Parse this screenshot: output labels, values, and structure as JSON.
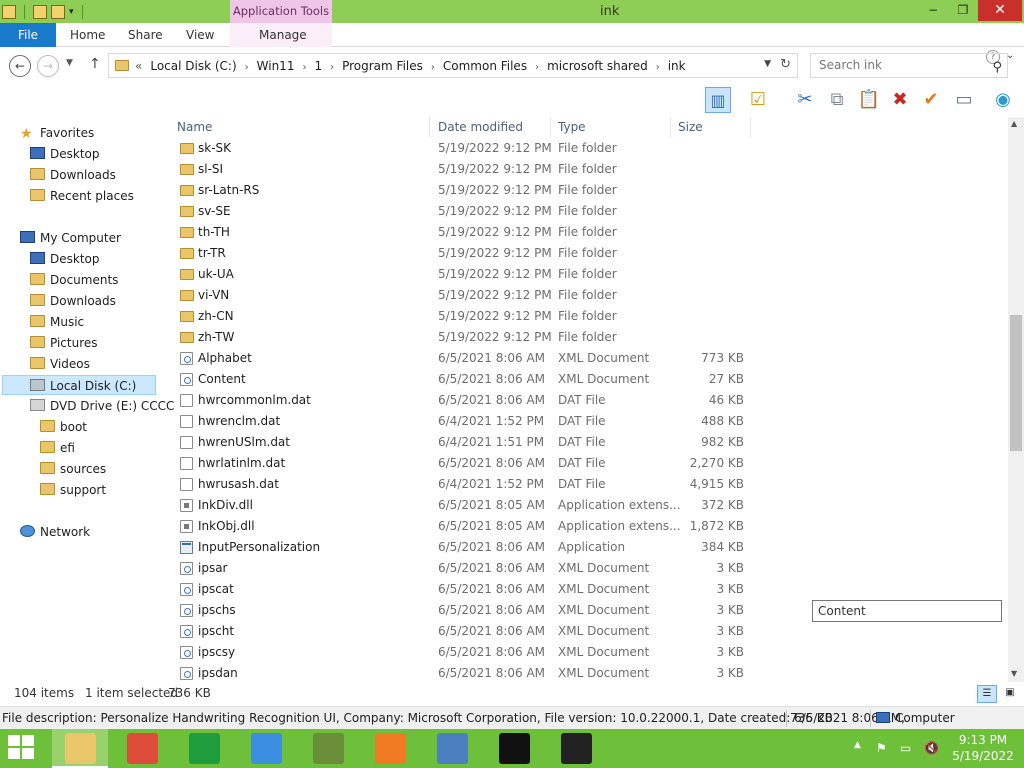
{
  "window": {
    "title": "ink",
    "context_tab_group": "Application Tools",
    "btn_min": "−",
    "btn_max": "❐",
    "btn_close": "✕"
  },
  "ribbon": {
    "tabs": [
      "File",
      "Home",
      "Share",
      "View",
      "Manage"
    ],
    "help_glyph": "?",
    "collapse_glyph": "⌄"
  },
  "address": {
    "overflow": "«",
    "crumbs": [
      "Local Disk (C:)",
      "Win11",
      "1",
      "Program Files",
      "Common Files",
      "microsoft shared",
      "ink"
    ],
    "separator": "›",
    "search_placeholder": "Search ink"
  },
  "nav_glyphs": {
    "back": "←",
    "forward": "→",
    "recent": "▼",
    "up": "↑",
    "dropdown": "▼",
    "refresh": "↻",
    "search": "⚲"
  },
  "toolbar_icons": [
    "layout-pane-icon",
    "properties-icon",
    "cut-icon",
    "copy-icon",
    "paste-icon",
    "delete-icon",
    "check-icon",
    "rename-icon",
    "globe-icon"
  ],
  "toolbar_glyphs": [
    "▥",
    "☑",
    "✂",
    "⧉",
    "📋",
    "✖",
    "✔",
    "▭",
    "◉"
  ],
  "navpane": {
    "favorites": {
      "label": "Favorites",
      "items": [
        "Desktop",
        "Downloads",
        "Recent places"
      ]
    },
    "computer": {
      "label": "My Computer",
      "items": [
        "Desktop",
        "Documents",
        "Downloads",
        "Music",
        "Pictures",
        "Videos",
        "Local Disk (C:)",
        "DVD Drive (E:) CCCC"
      ]
    },
    "dvd_children": [
      "boot",
      "efi",
      "sources",
      "support"
    ],
    "network": "Network"
  },
  "columns": {
    "name": "Name",
    "date": "Date modified",
    "type": "Type",
    "size": "Size",
    "sort_glyph": "^"
  },
  "files": [
    {
      "name": "sk-SK",
      "date": "5/19/2022 9:12 PM",
      "type": "File folder",
      "size": "",
      "icon": "folder"
    },
    {
      "name": "sl-SI",
      "date": "5/19/2022 9:12 PM",
      "type": "File folder",
      "size": "",
      "icon": "folder"
    },
    {
      "name": "sr-Latn-RS",
      "date": "5/19/2022 9:12 PM",
      "type": "File folder",
      "size": "",
      "icon": "folder"
    },
    {
      "name": "sv-SE",
      "date": "5/19/2022 9:12 PM",
      "type": "File folder",
      "size": "",
      "icon": "folder"
    },
    {
      "name": "th-TH",
      "date": "5/19/2022 9:12 PM",
      "type": "File folder",
      "size": "",
      "icon": "folder"
    },
    {
      "name": "tr-TR",
      "date": "5/19/2022 9:12 PM",
      "type": "File folder",
      "size": "",
      "icon": "folder"
    },
    {
      "name": "uk-UA",
      "date": "5/19/2022 9:12 PM",
      "type": "File folder",
      "size": "",
      "icon": "folder"
    },
    {
      "name": "vi-VN",
      "date": "5/19/2022 9:12 PM",
      "type": "File folder",
      "size": "",
      "icon": "folder"
    },
    {
      "name": "zh-CN",
      "date": "5/19/2022 9:12 PM",
      "type": "File folder",
      "size": "",
      "icon": "folder"
    },
    {
      "name": "zh-TW",
      "date": "5/19/2022 9:12 PM",
      "type": "File folder",
      "size": "",
      "icon": "folder"
    },
    {
      "name": "Alphabet",
      "date": "6/5/2021 8:06 AM",
      "type": "XML Document",
      "size": "773 KB",
      "icon": "xml"
    },
    {
      "name": "Content",
      "date": "6/5/2021 8:06 AM",
      "type": "XML Document",
      "size": "27 KB",
      "icon": "xml"
    },
    {
      "name": "hwrcommonlm.dat",
      "date": "6/5/2021 8:06 AM",
      "type": "DAT File",
      "size": "46 KB",
      "icon": "dat"
    },
    {
      "name": "hwrenclm.dat",
      "date": "6/4/2021 1:52 PM",
      "type": "DAT File",
      "size": "488 KB",
      "icon": "dat"
    },
    {
      "name": "hwrenUSlm.dat",
      "date": "6/4/2021 1:51 PM",
      "type": "DAT File",
      "size": "982 KB",
      "icon": "dat"
    },
    {
      "name": "hwrlatinlm.dat",
      "date": "6/5/2021 8:06 AM",
      "type": "DAT File",
      "size": "2,270 KB",
      "icon": "dat"
    },
    {
      "name": "hwrusash.dat",
      "date": "6/4/2021 1:52 PM",
      "type": "DAT File",
      "size": "4,915 KB",
      "icon": "dat"
    },
    {
      "name": "InkDiv.dll",
      "date": "6/5/2021 8:05 AM",
      "type": "Application extens...",
      "size": "372 KB",
      "icon": "dll"
    },
    {
      "name": "InkObj.dll",
      "date": "6/5/2021 8:05 AM",
      "type": "Application extens...",
      "size": "1,872 KB",
      "icon": "dll"
    },
    {
      "name": "InputPersonalization",
      "date": "6/5/2021 8:06 AM",
      "type": "Application",
      "size": "384 KB",
      "icon": "app"
    },
    {
      "name": "ipsar",
      "date": "6/5/2021 8:06 AM",
      "type": "XML Document",
      "size": "3 KB",
      "icon": "xml"
    },
    {
      "name": "ipscat",
      "date": "6/5/2021 8:06 AM",
      "type": "XML Document",
      "size": "3 KB",
      "icon": "xml"
    },
    {
      "name": "ipschs",
      "date": "6/5/2021 8:06 AM",
      "type": "XML Document",
      "size": "3 KB",
      "icon": "xml"
    },
    {
      "name": "ipscht",
      "date": "6/5/2021 8:06 AM",
      "type": "XML Document",
      "size": "3 KB",
      "icon": "xml"
    },
    {
      "name": "ipscsy",
      "date": "6/5/2021 8:06 AM",
      "type": "XML Document",
      "size": "3 KB",
      "icon": "xml"
    },
    {
      "name": "ipsdan",
      "date": "6/5/2021 8:06 AM",
      "type": "XML Document",
      "size": "3 KB",
      "icon": "xml"
    }
  ],
  "tooltip": "Content",
  "status": {
    "items": "104 items",
    "selected": "1 item selected",
    "size": "736 KB"
  },
  "info": {
    "description": "File description: Personalize Handwriting Recognition UI, Company: Microsoft Corporation, File version: 10.0.22000.1, Date created: 6/5/2021 8:06 AM,",
    "size": "736 KB",
    "location": "Computer"
  },
  "taskbar": {
    "apps": [
      {
        "name": "file-explorer-taskbar",
        "color": "#e9c66a"
      },
      {
        "name": "chrome-taskbar",
        "color": "#dd4b39"
      },
      {
        "name": "store-taskbar",
        "color": "#1f9d3c"
      },
      {
        "name": "app-butterfly-taskbar",
        "color": "#3c8fe0"
      },
      {
        "name": "minecraft-taskbar",
        "color": "#6b8e3a"
      },
      {
        "name": "firefox-taskbar",
        "color": "#f07b22"
      },
      {
        "name": "cube-app-taskbar",
        "color": "#4a7fc0"
      },
      {
        "name": "cmd-taskbar",
        "color": "#111111"
      },
      {
        "name": "7zip-taskbar",
        "color": "#222222"
      }
    ],
    "time": "9:13 PM",
    "date": "5/19/2022",
    "tray_glyphs": [
      "⚑",
      "▭",
      "🔇"
    ],
    "tray_up": "▲"
  }
}
